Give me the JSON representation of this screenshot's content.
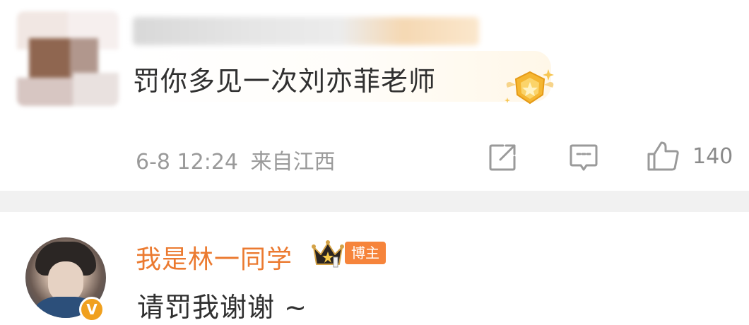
{
  "comment1": {
    "text": "罚你多见一次刘亦菲老师",
    "timestamp": "6-8 12:24",
    "location": "来自江西",
    "like_count": "140",
    "badge_icon": "gold-fan-badge-icon"
  },
  "comment2": {
    "username": "我是林一同学",
    "host_tag": "博主",
    "text": "请罚我谢谢 ~",
    "verified_mark": "V",
    "crown_icon": "crown-icon"
  },
  "colors": {
    "username_orange": "#eb7a30",
    "host_tag_orange": "#f6843b",
    "meta_gray": "#9a9a9a",
    "divider_gray": "#f1f1f1"
  }
}
